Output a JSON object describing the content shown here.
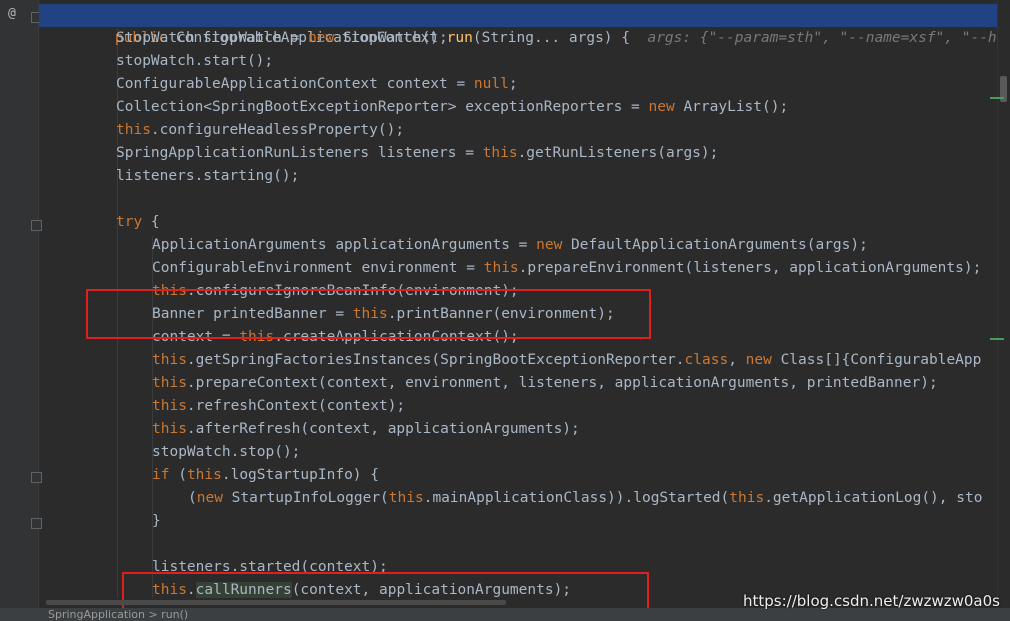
{
  "editor": {
    "gutter_symbol": "@",
    "method_hint": "args: {\"--param=sth\", \"--name=xsf\", \"--hel",
    "lines": [
      "public ConfigurableApplicationContext run(String... args) {",
      "StopWatch stopWatch = new StopWatch();",
      "stopWatch.start();",
      "ConfigurableApplicationContext context = null;",
      "Collection<SpringBootExceptionReporter> exceptionReporters = new ArrayList();",
      "this.configureHeadlessProperty();",
      "SpringApplicationRunListeners listeners = this.getRunListeners(args);",
      "listeners.starting();",
      "",
      "try {",
      "ApplicationArguments applicationArguments = new DefaultApplicationArguments(args);",
      "ConfigurableEnvironment environment = this.prepareEnvironment(listeners, applicationArguments);",
      "this.configureIgnoreBeanInfo(environment);",
      "Banner printedBanner = this.printBanner(environment);",
      "context = this.createApplicationContext();",
      "this.getSpringFactoriesInstances(SpringBootExceptionReporter.class, new Class[]{ConfigurableApp",
      "this.prepareContext(context, environment, listeners, applicationArguments, printedBanner);",
      "this.refreshContext(context);",
      "this.afterRefresh(context, applicationArguments);",
      "stopWatch.stop();",
      "if (this.logStartupInfo) {",
      "(new StartupInfoLogger(this.mainApplicationClass)).logStarted(this.getApplicationLog(), sto",
      "}",
      "",
      "listeners.started(context);",
      "this.callRunners(context, applicationArguments);"
    ]
  },
  "status": {
    "breadcrumb": "SpringApplication  >  run()"
  },
  "watermark": "https://blog.csdn.net/zwzwzw0a0s",
  "colors": {
    "keyword": "#cc7832",
    "method_decl": "#ffc66d",
    "highlight_box": "#e0201d",
    "current_line": "#214283"
  }
}
